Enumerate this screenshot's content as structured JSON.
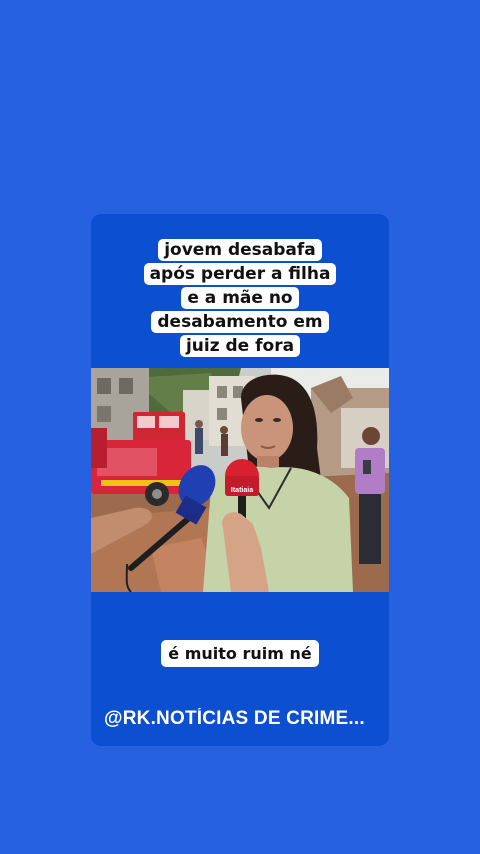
{
  "post": {
    "caption_lines": [
      "jovem desabafa",
      "após perder a filha",
      "e a mãe no",
      "desabamento em",
      "juiz de fora"
    ],
    "subtitle": "é muito ruim né",
    "handle": "@RK.NOTÍCIAS DE CRIME..."
  },
  "video": {
    "mic_brand": "Itatiaia",
    "colors": {
      "background": "#2561e0",
      "card": "#0c4fd0",
      "fire_truck": "#d8253a"
    }
  }
}
